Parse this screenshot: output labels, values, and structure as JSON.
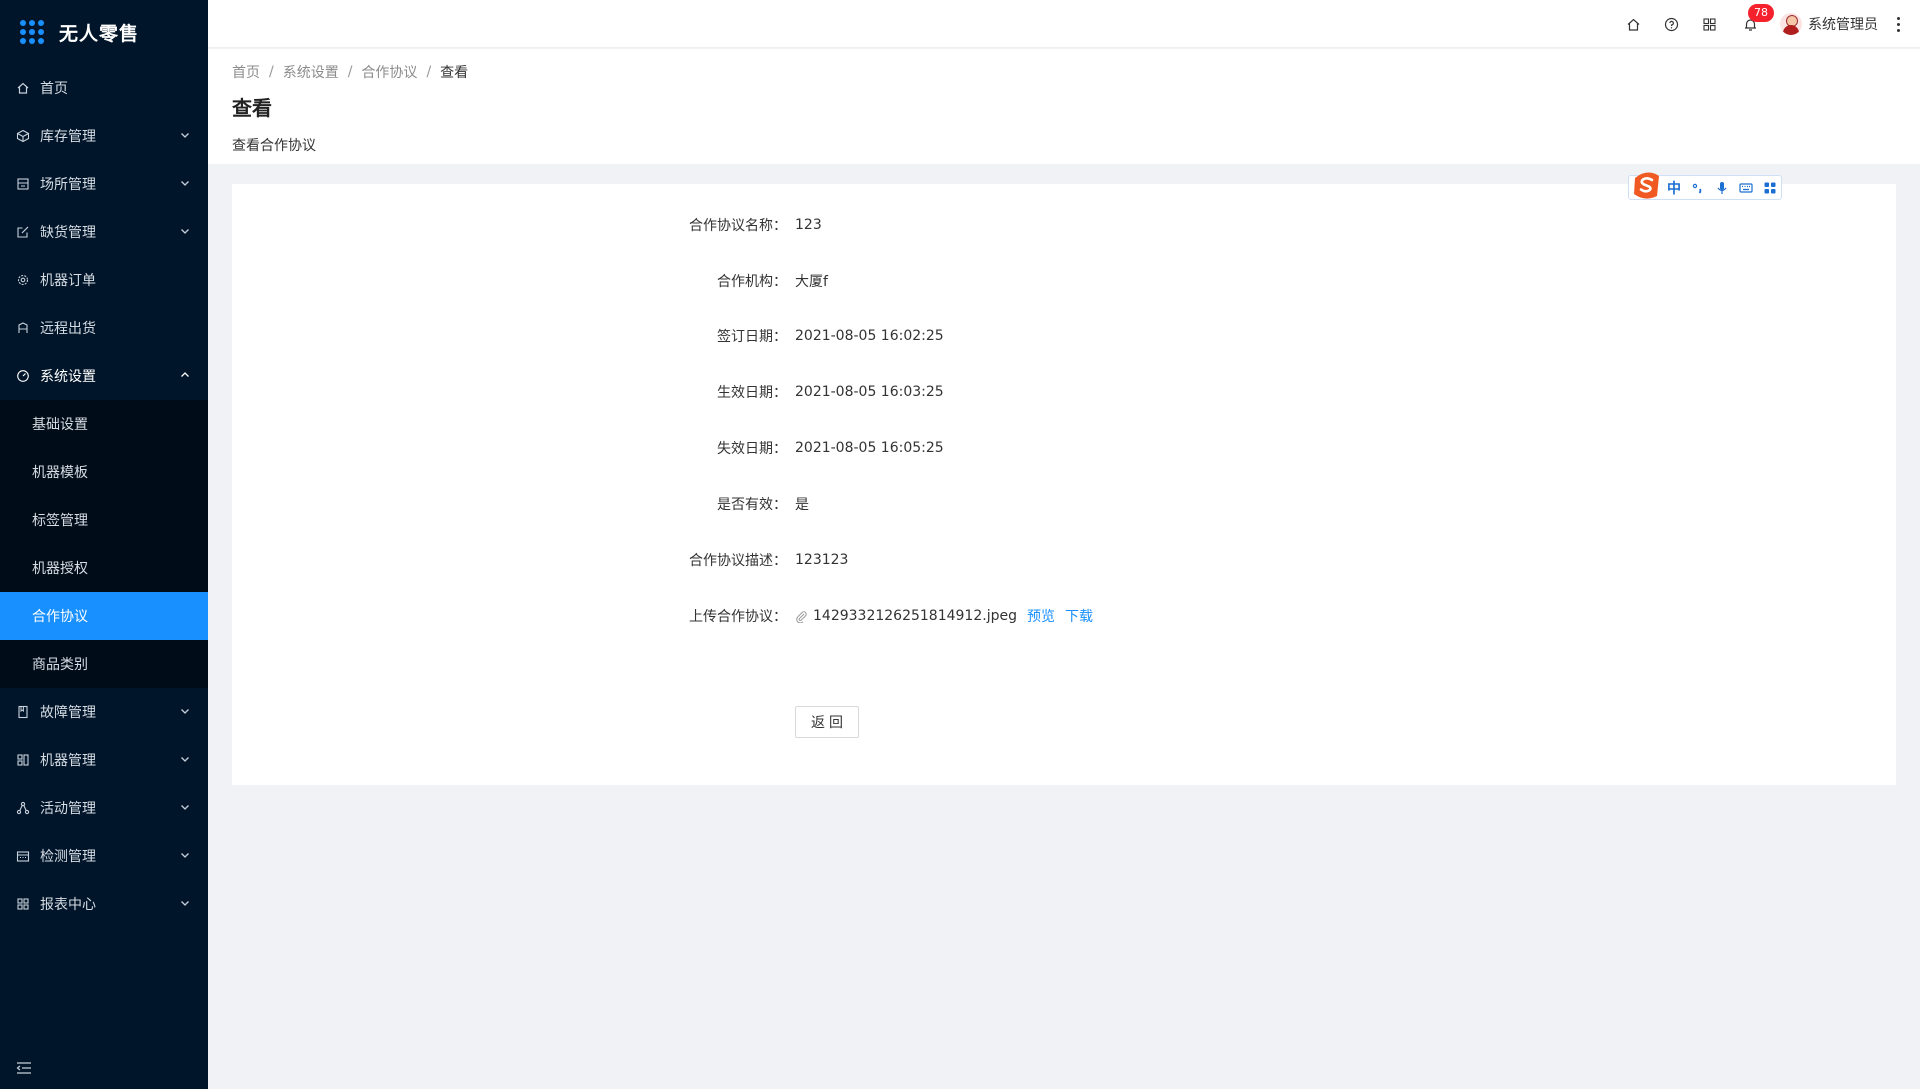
{
  "app": {
    "title": "无人零售"
  },
  "sidebar": {
    "items": [
      {
        "label": "首页",
        "icon": "home-icon"
      },
      {
        "label": "库存管理",
        "icon": "box-icon",
        "expandable": true
      },
      {
        "label": "场所管理",
        "icon": "store-icon",
        "expandable": true
      },
      {
        "label": "缺货管理",
        "icon": "edit-box-icon",
        "expandable": true
      },
      {
        "label": "机器订单",
        "icon": "gear-icon"
      },
      {
        "label": "远程出货",
        "icon": "user-icon"
      },
      {
        "label": "系统设置",
        "icon": "dashboard-icon",
        "expandable": true,
        "open": true
      },
      {
        "label": "故障管理",
        "icon": "book-icon",
        "expandable": true
      },
      {
        "label": "机器管理",
        "icon": "machine-icon",
        "expandable": true
      },
      {
        "label": "活动管理",
        "icon": "cluster-icon",
        "expandable": true
      },
      {
        "label": "检测管理",
        "icon": "calendar-icon",
        "expandable": true
      },
      {
        "label": "报表中心",
        "icon": "appstore-icon",
        "expandable": true
      }
    ],
    "submenu": [
      {
        "label": "基础设置"
      },
      {
        "label": "机器模板"
      },
      {
        "label": "标签管理"
      },
      {
        "label": "机器授权"
      },
      {
        "label": "合作协议",
        "active": true
      },
      {
        "label": "商品类别"
      }
    ]
  },
  "header": {
    "notification_count": "78",
    "user_name": "系统管理员"
  },
  "breadcrumb": [
    "首页",
    "系统设置",
    "合作协议",
    "查看"
  ],
  "page": {
    "title": "查看",
    "subtitle": "查看合作协议"
  },
  "detail": {
    "fields": [
      {
        "label": "合作协议名称：",
        "value": "123"
      },
      {
        "label": "合作机构：",
        "value": "大厦f"
      },
      {
        "label": "签订日期：",
        "value": "2021-08-05 16:02:25"
      },
      {
        "label": "生效日期：",
        "value": "2021-08-05 16:03:25"
      },
      {
        "label": "失效日期：",
        "value": "2021-08-05 16:05:25"
      },
      {
        "label": "是否有效：",
        "value": "是"
      },
      {
        "label": "合作协议描述：",
        "value": "123123"
      }
    ],
    "upload": {
      "label": "上传合作协议：",
      "file_name": "1429332126251814912.jpeg",
      "preview_label": "预览",
      "download_label": "下载"
    },
    "back_label": "返回"
  },
  "ime": {
    "lang": "中"
  },
  "colors": {
    "sidebar_bg": "#001529",
    "submenu_bg": "#000c17",
    "accent": "#1890ff",
    "badge": "#f5222d"
  }
}
